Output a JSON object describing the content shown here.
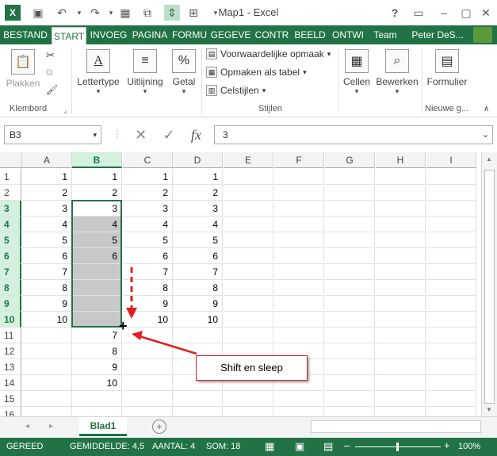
{
  "window": {
    "title": "Map1 - Excel"
  },
  "tabs": [
    {
      "label": "BESTAND"
    },
    {
      "label": "START"
    },
    {
      "label": "INVOEG"
    },
    {
      "label": "PAGINA"
    },
    {
      "label": "FORMU"
    },
    {
      "label": "GEGEVE"
    },
    {
      "label": "CONTR"
    },
    {
      "label": "BEELD"
    },
    {
      "label": "ONTWI"
    },
    {
      "label": "Team"
    },
    {
      "label": "Peter DeS..."
    }
  ],
  "ribbon": {
    "paste": "Plakken",
    "clipboard_group": "Klembord",
    "font": "Lettertype",
    "alignment": "Uitlijning",
    "number": "Getal",
    "cond_format": "Voorwaardelijke opmaak",
    "format_table": "Opmaken als tabel",
    "cell_styles": "Celstijlen",
    "styles_group": "Stijlen",
    "cells": "Cellen",
    "editing": "Bewerken",
    "form": "Formulier",
    "new_group": "Nieuwe g...",
    "percent_symbol": "%"
  },
  "formula_bar": {
    "name_box": "B3",
    "value": "3",
    "fx": "fx"
  },
  "columns": [
    "A",
    "B",
    "C",
    "D",
    "E",
    "F",
    "G",
    "H",
    "I"
  ],
  "rows": [
    "1",
    "2",
    "3",
    "4",
    "5",
    "6",
    "7",
    "8",
    "9",
    "10",
    "11",
    "12",
    "13",
    "14",
    "15",
    "16"
  ],
  "grid": {
    "A": [
      "1",
      "2",
      "3",
      "4",
      "5",
      "6",
      "7",
      "8",
      "9",
      "10"
    ],
    "B": [
      "1",
      "2",
      "3",
      "4",
      "5",
      "6",
      "",
      "",
      "",
      "",
      "7",
      "8",
      "9",
      "10"
    ],
    "C": [
      "1",
      "2",
      "3",
      "4",
      "5",
      "6",
      "7",
      "8",
      "9",
      "10"
    ],
    "D": [
      "1",
      "2",
      "3",
      "4",
      "5",
      "6",
      "7",
      "8",
      "9",
      "10"
    ]
  },
  "callout": {
    "text": "Shift en sleep"
  },
  "sheet": {
    "tab": "Blad1"
  },
  "status": {
    "ready": "GEREED",
    "average": "GEMIDDELDE: 4,5",
    "count": "AANTAL: 4",
    "sum": "SOM: 18",
    "zoom": "100%"
  },
  "colors": {
    "excel_green": "#217346",
    "selection_gray": "#c8c8c8",
    "arrow_red": "#e02020"
  }
}
